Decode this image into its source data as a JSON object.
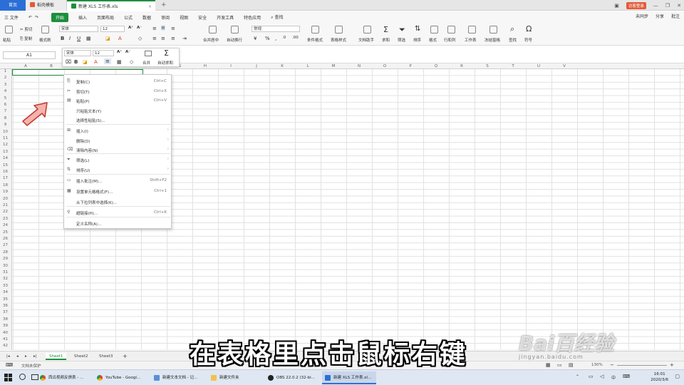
{
  "tabs": {
    "home": "首页",
    "template": "稻壳模板",
    "doc": "新建 XLS 工作表.xls"
  },
  "window": {
    "visitor_label": "访客登录"
  },
  "menu": {
    "file": "三 文件",
    "items": [
      "开始",
      "插入",
      "页面布局",
      "公式",
      "数据",
      "审阅",
      "视图",
      "安全",
      "开发工具",
      "特色应用"
    ],
    "search": "查找",
    "right": [
      "未同步",
      "分享",
      "批注"
    ]
  },
  "ribbon": {
    "paste": "粘贴",
    "cut": "剪切",
    "copy": "复制",
    "format_painter": "格式刷",
    "font": "宋体",
    "font_size": "12",
    "merge": "合并居中",
    "wrap": "自动换行",
    "number_format": "常规",
    "conditional": "条件格式",
    "table_style": "表格样式",
    "doc_helper": "文档助手",
    "sum": "求和",
    "filter": "筛选",
    "sort": "排序",
    "format": "格式",
    "rows_cols": "行和列",
    "worksheet": "工作表",
    "freeze": "冻结窗格",
    "find": "查找",
    "symbol": "符号"
  },
  "formula_bar": {
    "name_box": "A1"
  },
  "mini_toolbar": {
    "font": "宋体",
    "size": "12",
    "merge": "合并",
    "autosum": "自动求和"
  },
  "columns": [
    "A",
    "B",
    "C",
    "D",
    "E",
    "F",
    "G",
    "H",
    "I",
    "J",
    "K",
    "L",
    "M",
    "N",
    "O",
    "P",
    "Q",
    "R",
    "S",
    "T",
    "U",
    "V"
  ],
  "rows": [
    "1",
    "2",
    "3",
    "4",
    "5",
    "6",
    "7",
    "8",
    "9",
    "10",
    "11",
    "12",
    "13",
    "14",
    "15",
    "16",
    "17",
    "18",
    "19",
    "20",
    "21",
    "22",
    "23",
    "24",
    "25",
    "26",
    "27",
    "28",
    "29",
    "30",
    "31",
    "32",
    "33",
    "34",
    "35",
    "36",
    "37",
    "38",
    "39",
    "40",
    "41",
    "42"
  ],
  "context_menu": [
    {
      "icon": "copy-icon",
      "label": "复制(C)",
      "shortcut": "Ctrl+C"
    },
    {
      "icon": "cut-icon",
      "label": "剪切(T)",
      "shortcut": "Ctrl+X"
    },
    {
      "icon": "paste-icon",
      "label": "粘贴(P)",
      "shortcut": "Ctrl+V"
    },
    {
      "icon": "",
      "label": "只粘贴文本(Y)",
      "shortcut": ""
    },
    {
      "icon": "",
      "label": "选择性粘贴(S)...",
      "shortcut": ""
    },
    {
      "icon": "insert-icon",
      "label": "插入(I)",
      "shortcut": ""
    },
    {
      "icon": "",
      "label": "删除(D)",
      "shortcut": ""
    },
    {
      "icon": "eraser-icon",
      "label": "清除内容(N)",
      "shortcut": ""
    },
    {
      "icon": "filter-icon",
      "label": "筛选(L)",
      "shortcut": ""
    },
    {
      "icon": "sort-icon",
      "label": "排序(U)",
      "shortcut": ""
    },
    {
      "icon": "comment-icon",
      "label": "插入批注(M)...",
      "shortcut": "Shift+F2"
    },
    {
      "icon": "format-cells-icon",
      "label": "设置单元格格式(F)...",
      "shortcut": "Ctrl+1"
    },
    {
      "icon": "",
      "label": "从下拉列表中选择(K)...",
      "shortcut": ""
    },
    {
      "icon": "link-icon",
      "label": "超链接(H)...",
      "shortcut": "Ctrl+K"
    },
    {
      "icon": "",
      "label": "定义名称(A)...",
      "shortcut": ""
    }
  ],
  "sheets": [
    "Sheet1",
    "Sheet2",
    "Sheet3"
  ],
  "status": {
    "doc_status": "文档未保护",
    "zoom": "130%"
  },
  "caption": "在表格里点击鼠标右键",
  "watermark": "Bai百经验",
  "watermark_sub": "jingyan.baidu.com",
  "taskbar": {
    "apps": [
      "西瓜视频反馈表 - ...",
      "YouTube - Googl...",
      "新建文本文档 - 记...",
      "新建文件夹",
      "OBS 22.0.2 (32-bi...",
      "新建 XLS 工作表.xl..."
    ],
    "time": "16:01",
    "date": "2020/3/6"
  },
  "colors": {
    "accent": "#1d8f3d",
    "home_tab": "#2b6fd6",
    "arrow_fill": "#f4b3ae",
    "arrow_stroke": "#c0392b"
  }
}
